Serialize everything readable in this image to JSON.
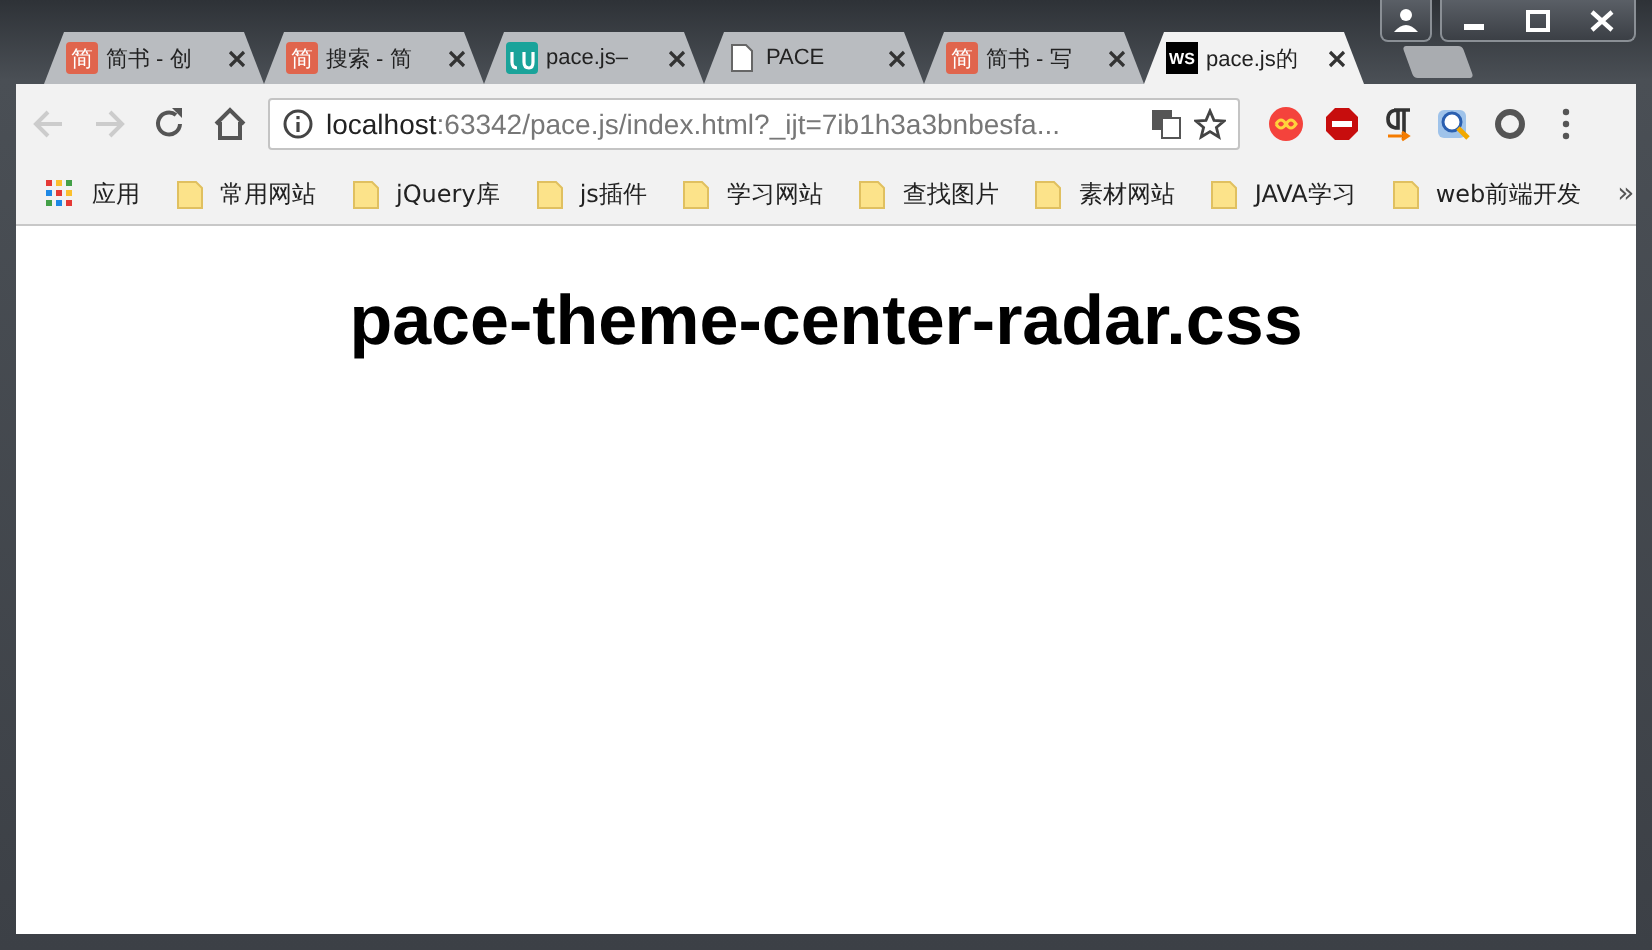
{
  "tabs": [
    {
      "kind": "letter",
      "icon_text": "简",
      "title": "简书 - 创",
      "selected": false
    },
    {
      "kind": "letter",
      "icon_text": "简",
      "title": "搜索 - 简",
      "selected": false
    },
    {
      "kind": "teal",
      "title": "pace.js–",
      "selected": false
    },
    {
      "kind": "document",
      "title": "PACE",
      "selected": false
    },
    {
      "kind": "letter",
      "icon_text": "简",
      "title": "简书 - 写",
      "selected": false
    },
    {
      "kind": "ws",
      "icon_text": "WS",
      "title": "pace.js的",
      "selected": true
    }
  ],
  "address": {
    "host": "localhost",
    "rest": ":63342/pace.js/index.html?_ijt=7ib1h3a3bnbesfa..."
  },
  "bookmarks": [
    {
      "kind": "apps",
      "label": "应用"
    },
    {
      "kind": "folder",
      "label": "常用网站"
    },
    {
      "kind": "folder",
      "label": "jQuery库"
    },
    {
      "kind": "folder",
      "label": "js插件"
    },
    {
      "kind": "folder",
      "label": "学习网站"
    },
    {
      "kind": "folder",
      "label": "查找图片"
    },
    {
      "kind": "folder",
      "label": "素材网站"
    },
    {
      "kind": "folder",
      "label": "JAVA学习"
    },
    {
      "kind": "folder",
      "label": "web前端开发"
    }
  ],
  "bookmarks_overflow": "»",
  "page": {
    "heading": "pace-theme-center-radar.css"
  }
}
